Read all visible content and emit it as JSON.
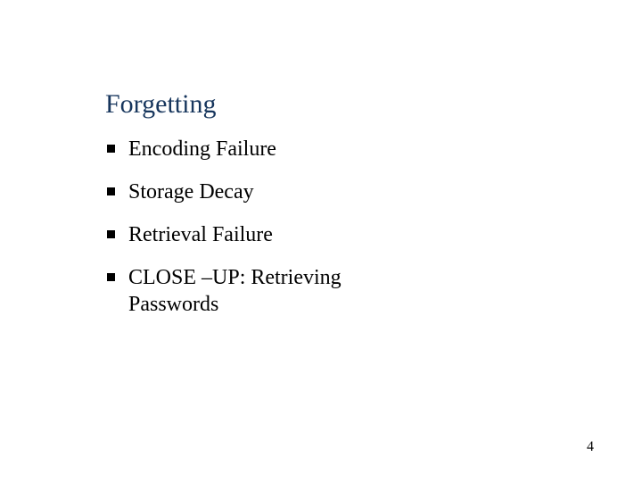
{
  "slide": {
    "title": "Forgetting",
    "bullets": [
      "Encoding Failure",
      "Storage Decay",
      "Retrieval Failure",
      "CLOSE –UP: Retrieving Passwords"
    ],
    "page_number": "4"
  }
}
